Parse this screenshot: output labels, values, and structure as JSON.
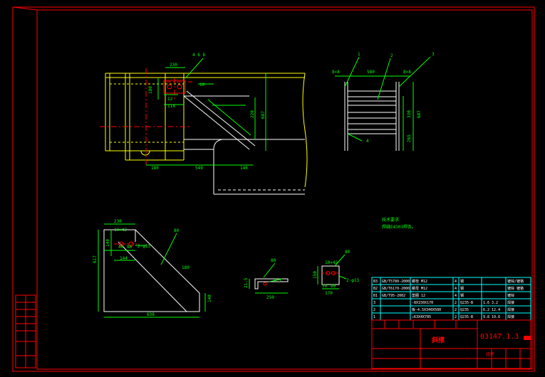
{
  "colors": {
    "background": "#000000",
    "border": "#ff0000",
    "outline": "#ffffff",
    "part_outline": "#ffff00",
    "dimension": "#00ff00",
    "centerline": "#ff0000",
    "leader": "#00ff00",
    "text_green": "#00ff00",
    "text_yellow": "#ffff00",
    "table_border": "#00ffff"
  },
  "front_view": {
    "dims": {
      "top_230": "230",
      "callout_466": "4 6 6",
      "left_180": "180",
      "d_12": "12",
      "d_114": "114",
      "d_10": "10",
      "d_220": "220",
      "d_687": "687",
      "bottom_180": "180",
      "bottom_549": "549",
      "bottom_146": "146"
    }
  },
  "side_view": {
    "dims": {
      "top_left": "8×8",
      "top_mid": "580",
      "top_right": "8×8",
      "right_330": "330",
      "right_687": "687",
      "right_265": "265",
      "weld": "4"
    },
    "balloons": [
      "1",
      "2",
      "3"
    ]
  },
  "notes": {
    "line1": "技术要求",
    "line2": "焊缝E4303焊条。"
  },
  "plate_view": {
    "dims": {
      "top": "230",
      "hole": "2-φ13",
      "d_40": "40",
      "d_80": "80",
      "d_144": "144",
      "d_140": "140",
      "left": "617",
      "diag": "180",
      "bottom": "638",
      "right": "140",
      "leader": "80"
    },
    "slot": "10×42"
  },
  "small_angle": {
    "dims": {
      "top": "80",
      "thick": "4.5",
      "bottom": "250",
      "left": "21.5"
    }
  },
  "small_plate": {
    "dims": {
      "slot": "10×42",
      "leader": "80",
      "hole": "2-φ13",
      "left": "150",
      "b1": "50",
      "b2": "80",
      "bottom": "170"
    }
  },
  "bom": {
    "rows": [
      {
        "no": "B3",
        "code": "GB/T5780-2000",
        "name": "螺栓 M12",
        "qty": "4",
        "mat": "钢",
        "wt": "",
        "note": "镀锌/镀铬"
      },
      {
        "no": "B2",
        "code": "GB/T6170-2000",
        "name": "螺母 M12",
        "qty": "4",
        "mat": "钢",
        "wt": "",
        "note": "镀锌 镀铬"
      },
      {
        "no": "B1",
        "code": "GB/T95-2002",
        "name": "垫圈 12",
        "qty": "4",
        "mat": "钢",
        "wt": "",
        "note": "镀锌"
      },
      {
        "no": "3",
        "code": "",
        "name": "-8X150X170",
        "qty": "2",
        "mat": "Q235-B",
        "wt": "1.6  3.2",
        "note": "焊接"
      },
      {
        "no": "2",
        "code": "",
        "name": "板-4.5X340X500",
        "qty": "2",
        "mat": "Q235",
        "wt": "6.2  12.4",
        "note": "焊接"
      },
      {
        "no": "1",
        "code": "",
        "name": "∠63X4X785",
        "qty": "2",
        "mat": "Q235-B",
        "wt": "9.8  19.6",
        "note": "焊接"
      }
    ],
    "header": [
      "序号",
      "代号",
      "名称",
      "数量",
      "材料",
      "单件 总计",
      "备注"
    ]
  },
  "title_block": {
    "name": "斜撑",
    "drawing_no": "03147.1.3",
    "unit": "组件"
  }
}
